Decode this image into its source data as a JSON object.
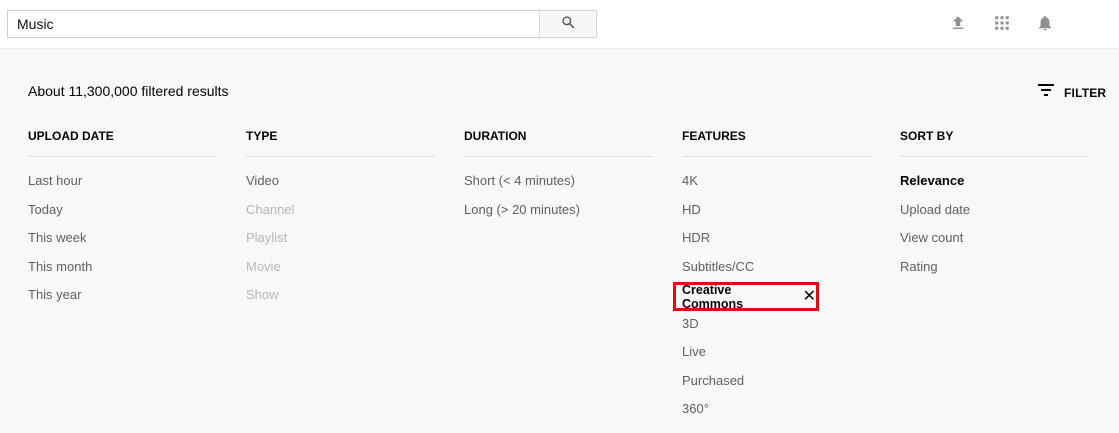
{
  "search": {
    "value": "Music"
  },
  "results_count": "About 11,300,000 filtered results",
  "filter_label": "FILTER",
  "columns": [
    {
      "header": "UPLOAD DATE",
      "options": [
        {
          "label": "Last hour",
          "state": "normal"
        },
        {
          "label": "Today",
          "state": "normal"
        },
        {
          "label": "This week",
          "state": "normal"
        },
        {
          "label": "This month",
          "state": "normal"
        },
        {
          "label": "This year",
          "state": "normal"
        }
      ]
    },
    {
      "header": "TYPE",
      "options": [
        {
          "label": "Video",
          "state": "normal"
        },
        {
          "label": "Channel",
          "state": "disabled"
        },
        {
          "label": "Playlist",
          "state": "disabled"
        },
        {
          "label": "Movie",
          "state": "disabled"
        },
        {
          "label": "Show",
          "state": "disabled"
        }
      ]
    },
    {
      "header": "DURATION",
      "options": [
        {
          "label": "Short (< 4 minutes)",
          "state": "normal"
        },
        {
          "label": "Long (> 20 minutes)",
          "state": "normal"
        }
      ]
    },
    {
      "header": "FEATURES",
      "options": [
        {
          "label": "4K",
          "state": "normal"
        },
        {
          "label": "HD",
          "state": "normal"
        },
        {
          "label": "HDR",
          "state": "normal"
        },
        {
          "label": "Subtitles/CC",
          "state": "normal"
        },
        {
          "label": "Creative Commons",
          "state": "applied"
        },
        {
          "label": "3D",
          "state": "normal"
        },
        {
          "label": "Live",
          "state": "normal"
        },
        {
          "label": "Purchased",
          "state": "normal"
        },
        {
          "label": "360°",
          "state": "normal"
        }
      ]
    },
    {
      "header": "SORT BY",
      "options": [
        {
          "label": "Relevance",
          "state": "selected"
        },
        {
          "label": "Upload date",
          "state": "normal"
        },
        {
          "label": "View count",
          "state": "normal"
        },
        {
          "label": "Rating",
          "state": "normal"
        }
      ]
    }
  ],
  "icons": {
    "search": "search-icon",
    "upload": "upload-icon",
    "apps": "apps-grid-icon",
    "notifications": "bell-icon",
    "filter": "filter-icon",
    "remove": "close-icon"
  },
  "colors": {
    "highlight_border": "#e30613",
    "disabled_text": "#b8b8b8",
    "muted_text": "#606060"
  }
}
